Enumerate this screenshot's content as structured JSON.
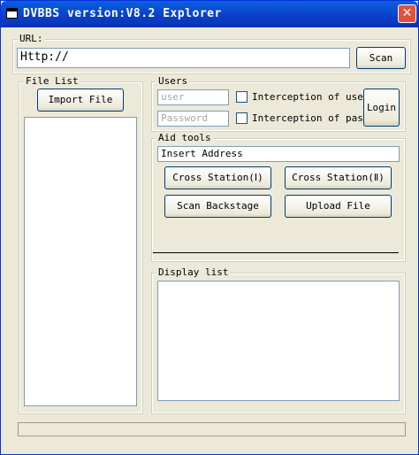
{
  "window": {
    "title": "DVBBS version:V8.2  Explorer",
    "close_label": "✕"
  },
  "url_group": {
    "legend": "URL:",
    "value": "Http://",
    "scan_label": "Scan"
  },
  "file_list": {
    "legend": "File List",
    "import_label": "Import File"
  },
  "users": {
    "legend": "Users",
    "user_placeholder": "user",
    "password_placeholder": "Password",
    "intercept_user_label": "Interception of user",
    "intercept_pass_label": "Interception of pass",
    "login_label": "Login"
  },
  "aid_tools": {
    "legend": "Aid tools",
    "address_value": "Insert Address",
    "cross1_label": "Cross Station(Ⅰ)",
    "cross2_label": "Cross Station(Ⅱ)",
    "scan_backstage_label": "Scan Backstage",
    "upload_label": "Upload File"
  },
  "display": {
    "legend": "Display list"
  }
}
